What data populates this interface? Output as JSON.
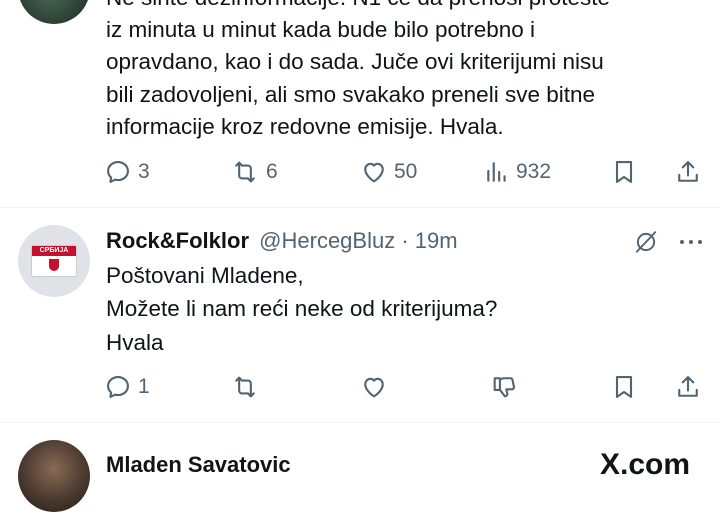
{
  "tweet1": {
    "lines": [
      "Ne širite dezinformacije. N1 će da prenosi proteste",
      "iz minuta u minut kada bude bilo potrebno i",
      "opravdano, kao i do sada. Juče ovi kriterijumi nisu",
      "bili zadovoljeni, ali smo svakako preneli sve bitne",
      "informacije kroz redovne emisije. Hvala."
    ],
    "actions": {
      "replies": "3",
      "reposts": "6",
      "likes": "50",
      "views": "932"
    }
  },
  "tweet2": {
    "name": "Rock&Folklor",
    "handle": "@HercegBluz",
    "sep": " · ",
    "time": "19m",
    "avatar_text": "СРБИЈА",
    "lines": [
      "Poštovani Mladene,",
      "Možete li nam reći neke od kriterijuma?",
      "Hvala"
    ],
    "actions": {
      "replies": "1"
    }
  },
  "tweet3": {
    "name": "Mladen Savatovic"
  },
  "watermark": "X.com",
  "colors": {
    "text": "#0f1419",
    "muted": "#536471",
    "divider": "#eff3f4"
  }
}
